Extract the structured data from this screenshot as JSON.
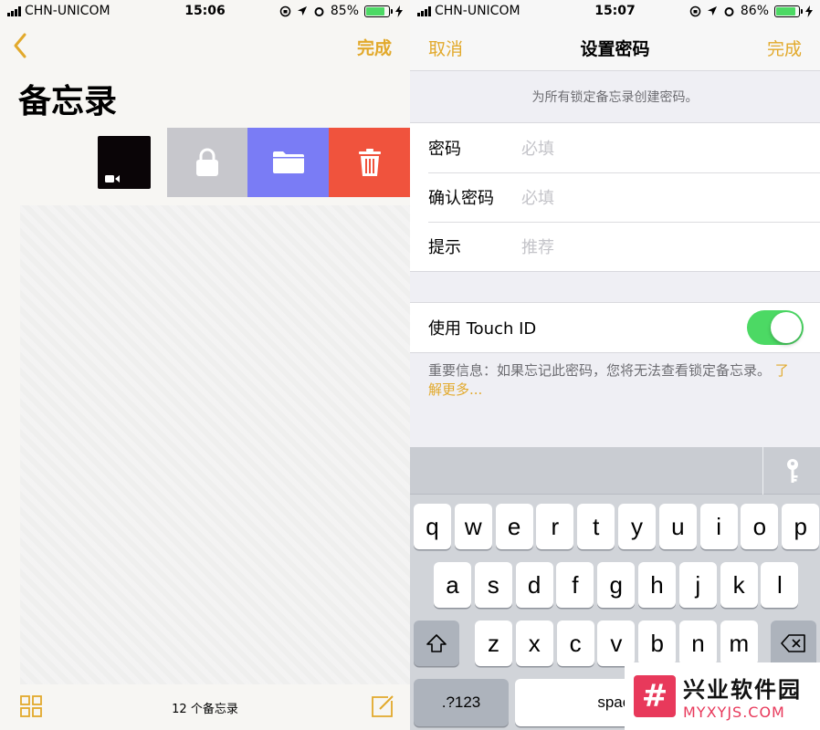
{
  "left": {
    "status": {
      "carrier": "CHN-UNICOM",
      "time": "15:06",
      "battery": "85%",
      "battery_level": 0.85
    },
    "nav": {
      "done": "完成"
    },
    "title": "备忘录",
    "toolbar": {
      "count": "12 个备忘录"
    }
  },
  "right": {
    "status": {
      "carrier": "CHN-UNICOM",
      "time": "15:07",
      "battery": "86%",
      "battery_level": 0.86
    },
    "nav": {
      "cancel": "取消",
      "title": "设置密码",
      "done": "完成"
    },
    "hint": "为所有锁定备忘录创建密码。",
    "fields": [
      {
        "label": "密码",
        "placeholder": "必填"
      },
      {
        "label": "确认密码",
        "placeholder": "必填"
      },
      {
        "label": "提示",
        "placeholder": "推荐"
      }
    ],
    "touch_id": {
      "label": "使用 Touch ID",
      "enabled": true
    },
    "note": {
      "text": "重要信息：如果忘记此密码，您将无法查看锁定备忘录。",
      "link": "了解更多..."
    },
    "keyboard": {
      "row1": [
        "q",
        "w",
        "e",
        "r",
        "t",
        "y",
        "u",
        "i",
        "o",
        "p"
      ],
      "row2": [
        "a",
        "s",
        "d",
        "f",
        "g",
        "h",
        "j",
        "k",
        "l"
      ],
      "row3": [
        "z",
        "x",
        "c",
        "v",
        "b",
        "n",
        "m"
      ],
      "numbers_key": ".?123",
      "space_key": "space"
    }
  },
  "watermark": {
    "cn": "兴业软件园",
    "en": "MYXYJS.COM"
  },
  "colors": {
    "accent": "#e2a92b",
    "lock": "#c7c7cc",
    "folder": "#7a7cf5",
    "trash": "#f0533d",
    "toggle_on": "#4cd964"
  }
}
